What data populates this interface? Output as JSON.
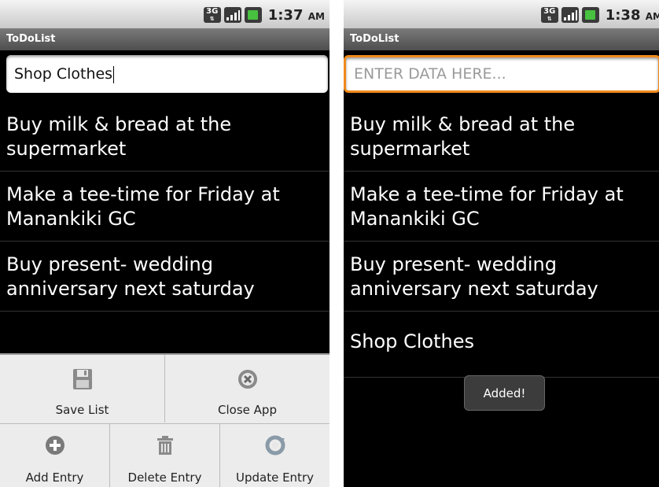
{
  "left": {
    "status_time": "1:37",
    "status_ampm": "AM",
    "app_title": "ToDoList",
    "input_value": "Shop Clothes",
    "items": [
      "Buy milk & bread at the supermarket",
      "Make a tee-time for Friday at Manankiki GC",
      "Buy present- wedding anniversary next saturday"
    ],
    "menu": {
      "save": "Save List",
      "close": "Close App",
      "add": "Add Entry",
      "delete": "Delete Entry",
      "update": "Update Entry"
    }
  },
  "right": {
    "status_time": "1:38",
    "status_ampm": "AM",
    "app_title": "ToDoList",
    "input_placeholder": "ENTER DATA HERE...",
    "items": [
      "Buy milk & bread at the supermarket",
      "Make a tee-time for Friday at Manankiki GC",
      "Buy present- wedding anniversary next saturday",
      "Shop Clothes"
    ],
    "toast": "Added!"
  },
  "colors": {
    "focus_border": "#f08a1c",
    "battery": "#47c13f",
    "background": "#000000"
  }
}
